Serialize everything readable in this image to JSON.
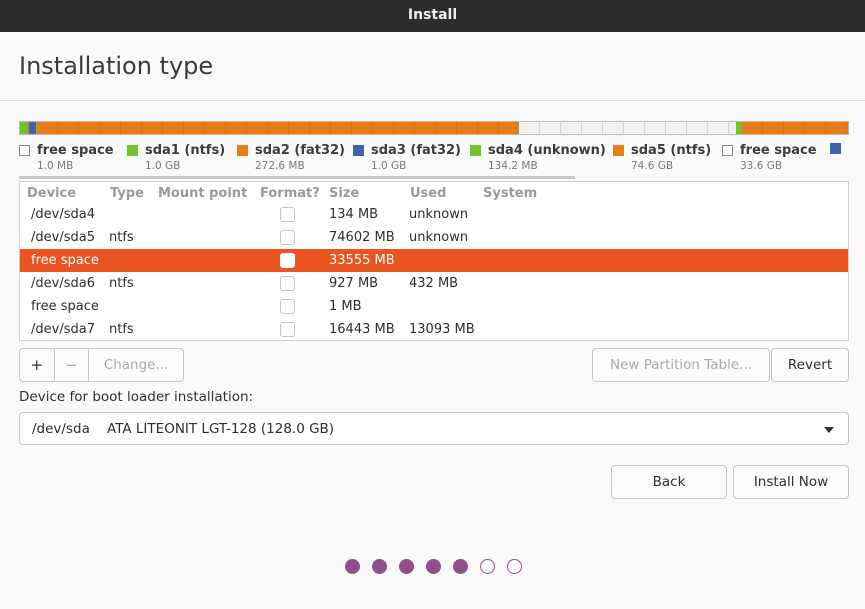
{
  "window": {
    "title": "Install"
  },
  "page": {
    "title": "Installation type"
  },
  "colors": {
    "orange": "#e67e1c",
    "green": "#73c32a",
    "blue": "#3c64a8",
    "free": "#ffffff",
    "accent": "#e95420",
    "dot": "#924d8b"
  },
  "partition_bar": {
    "segments": [
      {
        "name": "free",
        "color": "#ffffff",
        "fraction": 0.0
      },
      {
        "name": "sda1",
        "color": "#73c32a",
        "fraction": 0.008
      },
      {
        "name": "sda2",
        "color": "#e67e1c",
        "fraction": 0.0021
      },
      {
        "name": "sda3",
        "color": "#3c64a8",
        "fraction": 0.008
      },
      {
        "name": "sda4",
        "color": "#73c32a",
        "fraction": 0.001
      },
      {
        "name": "sda5",
        "color": "#e67e1c",
        "fraction": 0.5816
      },
      {
        "name": "free2",
        "color": "#f2f2f2",
        "fraction": 0.2616
      },
      {
        "name": "sda6",
        "color": "#73c32a",
        "fraction": 0.0072
      },
      {
        "name": "sda7",
        "color": "#e67e1c",
        "fraction": 0.1282
      }
    ]
  },
  "legend": [
    {
      "label": "free space",
      "size": "1.0 MB",
      "color": "#ffffff"
    },
    {
      "label": "sda1 (ntfs)",
      "size": "1.0 GB",
      "color": "#73c32a"
    },
    {
      "label": "sda2 (fat32)",
      "size": "272.6 MB",
      "color": "#e67e1c"
    },
    {
      "label": "sda3 (fat32)",
      "size": "1.0 GB",
      "color": "#3c64a8"
    },
    {
      "label": "sda4 (unknown)",
      "size": "134.2 MB",
      "color": "#73c32a"
    },
    {
      "label": "sda5 (ntfs)",
      "size": "74.6 GB",
      "color": "#e67e1c"
    },
    {
      "label": "free space",
      "size": "33.6 GB",
      "color": "#ffffff"
    },
    {
      "label": "",
      "size": "",
      "color": "#3c64a8"
    }
  ],
  "table": {
    "headers": {
      "device": "Device",
      "type": "Type",
      "mount": "Mount point",
      "format": "Format?",
      "size": "Size",
      "used": "Used",
      "system": "System"
    },
    "rows": [
      {
        "device": "/dev/sda4",
        "type": "",
        "mount": "",
        "size": "134 MB",
        "used": "unknown",
        "selected": false
      },
      {
        "device": "/dev/sda5",
        "type": "ntfs",
        "mount": "",
        "size": "74602 MB",
        "used": "unknown",
        "selected": false
      },
      {
        "device": "free space",
        "type": "",
        "mount": "",
        "size": "33555 MB",
        "used": "",
        "selected": true
      },
      {
        "device": "/dev/sda6",
        "type": "ntfs",
        "mount": "",
        "size": "927 MB",
        "used": "432 MB",
        "selected": false
      },
      {
        "device": "free space",
        "type": "",
        "mount": "",
        "size": "1 MB",
        "used": "",
        "selected": false
      },
      {
        "device": "/dev/sda7",
        "type": "ntfs",
        "mount": "",
        "size": "16443 MB",
        "used": "13093 MB",
        "selected": false
      }
    ]
  },
  "buttons": {
    "add": "+",
    "remove": "−",
    "change": "Change...",
    "new_table": "New Partition Table...",
    "revert": "Revert",
    "back": "Back",
    "install": "Install Now"
  },
  "bootloader": {
    "label": "Device for boot loader installation:",
    "value": "/dev/sda    ATA LITEONIT LGT-128 (128.0 GB)"
  },
  "progress": {
    "total_steps": 7,
    "current_step": 5
  }
}
